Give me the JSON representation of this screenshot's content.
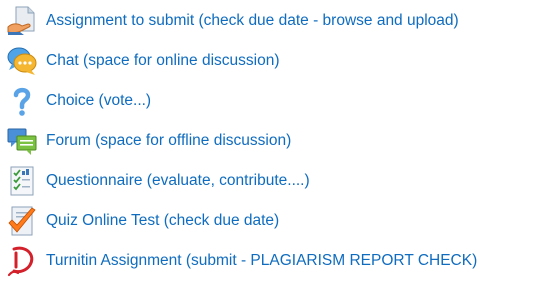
{
  "activities": [
    {
      "icon": "assignment-icon",
      "label": "Assignment to submit (check due date - browse and upload)"
    },
    {
      "icon": "chat-icon",
      "label": "Chat (space for online discussion)"
    },
    {
      "icon": "choice-icon",
      "label": "Choice (vote...)"
    },
    {
      "icon": "forum-icon",
      "label": "Forum (space for offline discussion)"
    },
    {
      "icon": "questionnaire-icon",
      "label": "Questionnaire (evaluate, contribute....)"
    },
    {
      "icon": "quiz-icon",
      "label": "Quiz Online Test (check due date)"
    },
    {
      "icon": "turnitin-icon",
      "label": "Turnitin Assignment (submit - PLAGIARISM REPORT CHECK)"
    }
  ],
  "colors": {
    "link": "#0f6cbf"
  }
}
